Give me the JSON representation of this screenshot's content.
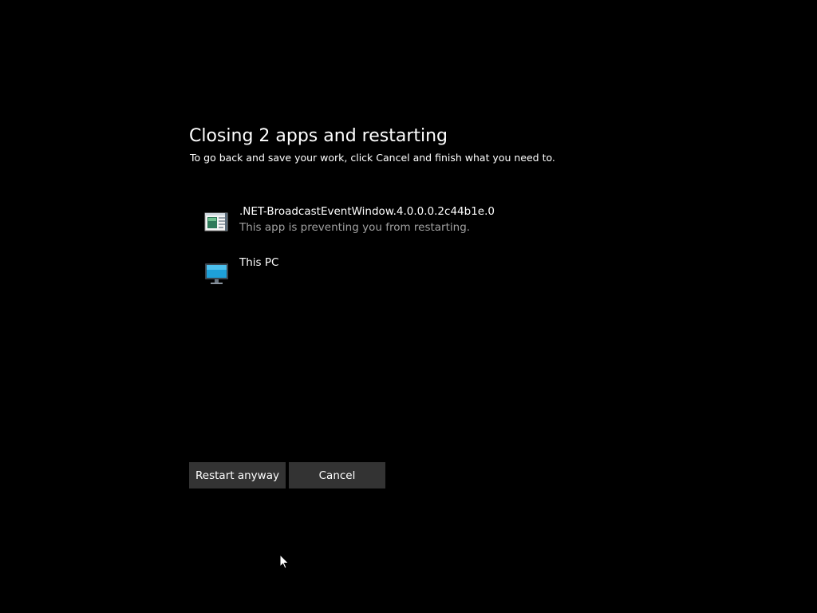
{
  "dialog": {
    "title": "Closing 2 apps and restarting",
    "subtitle": "To go back and save your work, click Cancel and finish what you need to."
  },
  "apps": [
    {
      "name": ".NET-BroadcastEventWindow.4.0.0.0.2c44b1e.0",
      "status": "This app is preventing you from restarting.",
      "icon": "app-window-icon"
    },
    {
      "name": "This PC",
      "status": "",
      "icon": "computer-monitor-icon"
    }
  ],
  "buttons": {
    "restart_label": "Restart anyway",
    "cancel_label": "Cancel"
  },
  "colors": {
    "background": "#000000",
    "button_bg": "#333333",
    "secondary_text": "#a0a0a0",
    "monitor_accent": "#1ea0d8"
  }
}
